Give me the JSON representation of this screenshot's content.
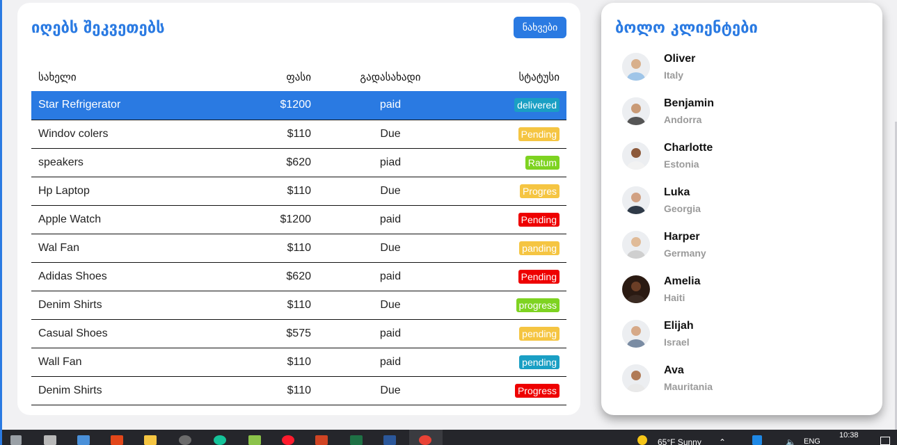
{
  "orders": {
    "title": "იღებს შეკვეთებს",
    "view_button": "ნახვები",
    "columns": [
      "სახელი",
      "ფასი",
      "გადასახადი",
      "სტატუსი"
    ],
    "rows": [
      {
        "name": "Star Refrigerator",
        "price": "$1200",
        "payment": "paid",
        "status": "delivered",
        "status_color": "#1a9fc4"
      },
      {
        "name": "Windov colers",
        "price": "$110",
        "payment": "Due",
        "status": "Pending",
        "status_color": "#f5c542"
      },
      {
        "name": "speakers",
        "price": "$620",
        "payment": "piad",
        "status": "Ratum",
        "status_color": "#7ed321"
      },
      {
        "name": "Hp Laptop",
        "price": "$110",
        "payment": "Due",
        "status": "Progres",
        "status_color": "#f5c542"
      },
      {
        "name": "Apple Watch",
        "price": "$1200",
        "payment": "paid",
        "status": "Pending",
        "status_color": "#ee0000"
      },
      {
        "name": "Wal Fan",
        "price": "$110",
        "payment": "Due",
        "status": "panding",
        "status_color": "#f5c542"
      },
      {
        "name": "Adidas Shoes",
        "price": "$620",
        "payment": "paid",
        "status": "Pending",
        "status_color": "#ee0000"
      },
      {
        "name": "Denim Shirts",
        "price": "$110",
        "payment": "Due",
        "status": "progress",
        "status_color": "#7ed321"
      },
      {
        "name": "Casual Shoes",
        "price": "$575",
        "payment": "paid",
        "status": "pending",
        "status_color": "#f5c542"
      },
      {
        "name": "Wall Fan",
        "price": "$110",
        "payment": "paid",
        "status": "pending",
        "status_color": "#1a9fc4"
      },
      {
        "name": "Denim Shirts",
        "price": "$110",
        "payment": "Due",
        "status": "Progress",
        "status_color": "#ee0000"
      }
    ]
  },
  "customers": {
    "title": "ბოლო კლიენტები",
    "items": [
      {
        "name": "Oliver",
        "country": "Italy"
      },
      {
        "name": "Benjamin",
        "country": "Andorra"
      },
      {
        "name": "Charlotte",
        "country": "Estonia"
      },
      {
        "name": "Luka",
        "country": "Georgia"
      },
      {
        "name": "Harper",
        "country": "Germany"
      },
      {
        "name": "Amelia",
        "country": "Haiti"
      },
      {
        "name": "Elijah",
        "country": "Israel"
      },
      {
        "name": "Ava",
        "country": "Mauritania"
      }
    ]
  },
  "taskbar": {
    "weather": "65°F  Sunny",
    "language": "ENG",
    "time": "10:38"
  },
  "colors": {
    "accent": "#2a7ae2"
  }
}
